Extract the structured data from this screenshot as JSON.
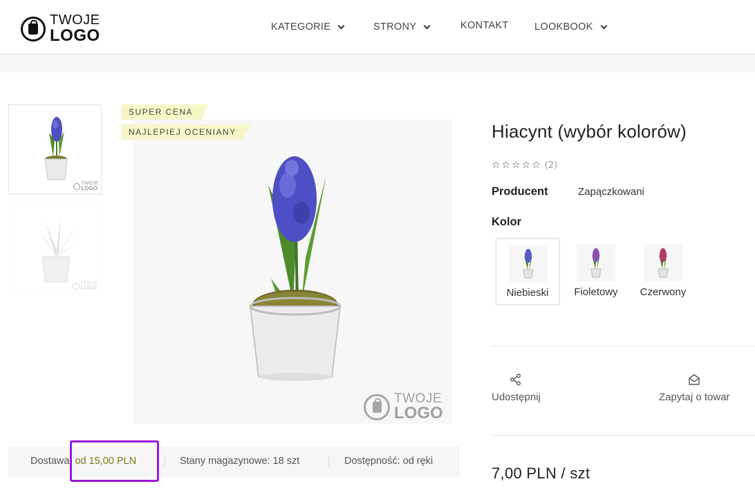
{
  "header": {
    "logo": {
      "line1": "TWOJE",
      "line2": "LOGO"
    },
    "nav": [
      {
        "label": "KATEGORIE"
      },
      {
        "label": "STRONY"
      },
      {
        "label": "KONTAKT"
      },
      {
        "label": "LOOKBOOK"
      }
    ]
  },
  "gallery": {
    "badges": [
      "SUPER CENA",
      "NAJLEPIEJ OCENIANY"
    ],
    "watermark": {
      "line1": "TWOJE",
      "line2": "LOGO"
    },
    "thumb_watermark": {
      "line1": "TWOJE",
      "line2": "LOGO"
    }
  },
  "info_bar": {
    "delivery_label": "Dostawa:",
    "delivery_value": "od 15,00 PLN",
    "stock": "Stany magazynowe: 18 szt",
    "availability": "Dostępność: od ręki"
  },
  "product": {
    "title": "Hiacynt (wybór kolorów)",
    "rating_stars": "☆☆☆☆☆",
    "rating_count": "(2)",
    "producer_label": "Producent",
    "producer_value": "Zapączkowani",
    "color_label": "Kolor",
    "colors": [
      {
        "name": "Niebieski",
        "flower_color": "#5b58c9",
        "selected": true
      },
      {
        "name": "Fioletowy",
        "flower_color": "#8d4fb5",
        "selected": false
      },
      {
        "name": "Czerwony",
        "flower_color": "#b23a68",
        "selected": false
      }
    ],
    "actions": [
      {
        "label": "Udostępnij",
        "icon": "share-icon"
      },
      {
        "label": "Zapytaj o towar",
        "icon": "envelope-open-icon"
      }
    ],
    "price": "7,00 PLN / szt"
  },
  "colors": {
    "highlight": "#9b19d6",
    "badge_bg": "#f6f7c8",
    "accent_text": "#7a7a10"
  }
}
